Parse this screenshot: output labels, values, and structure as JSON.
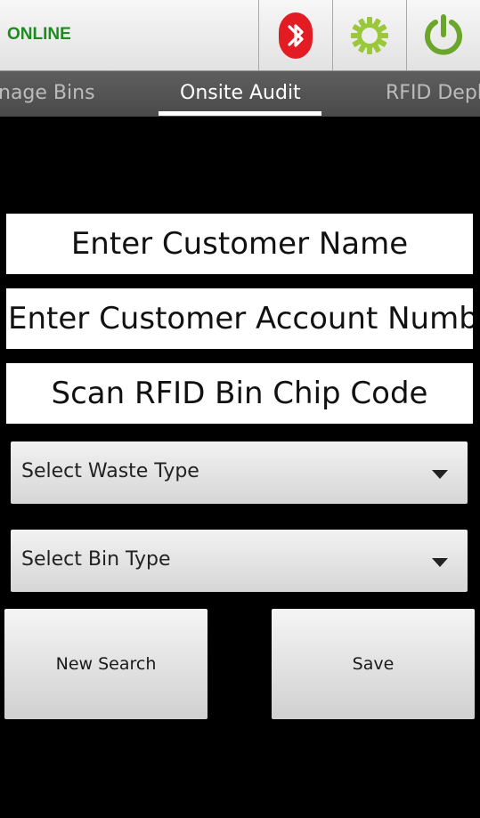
{
  "status": {
    "text": "ONLINE",
    "color": "#1f8a1f"
  },
  "toolbar": {
    "icons": [
      "bluetooth-icon",
      "settings-gear-icon",
      "power-icon"
    ]
  },
  "tabs": [
    {
      "label": "Manage Bins",
      "visible_label": "nage Bins",
      "active": false
    },
    {
      "label": "Onsite Audit",
      "active": true
    },
    {
      "label": "RFID Depl",
      "active": false
    }
  ],
  "fields": {
    "customer_name": "Enter Customer Name",
    "account_number": "Enter Customer Account Numb",
    "rfid_code": "Scan RFID Bin Chip Code"
  },
  "selects": {
    "waste_type": "Select Waste Type",
    "bin_type": "Select Bin Type"
  },
  "buttons": {
    "new_search": "New Search",
    "save": "Save"
  }
}
